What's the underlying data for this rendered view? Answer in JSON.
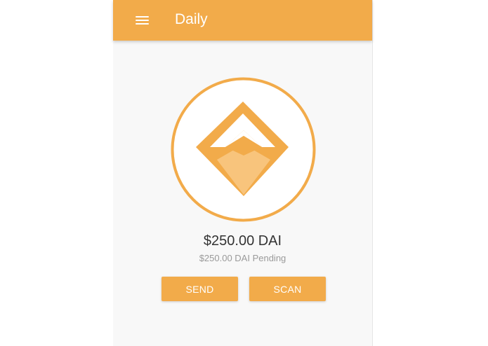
{
  "appbar": {
    "title": "Daily",
    "menu_icon": "hamburger-menu-icon",
    "color": "#f2ab4a"
  },
  "logo": {
    "icon": "dai-diamond-logo-icon",
    "colors": {
      "ring": "#f2ab4a",
      "diamond_dark": "#f2ab4a",
      "diamond_light": "#f8c47c"
    }
  },
  "wallet": {
    "balance": "$250.00 DAI",
    "pending": "$250.00 DAI Pending"
  },
  "actions": {
    "send_label": "SEND",
    "scan_label": "SCAN"
  }
}
